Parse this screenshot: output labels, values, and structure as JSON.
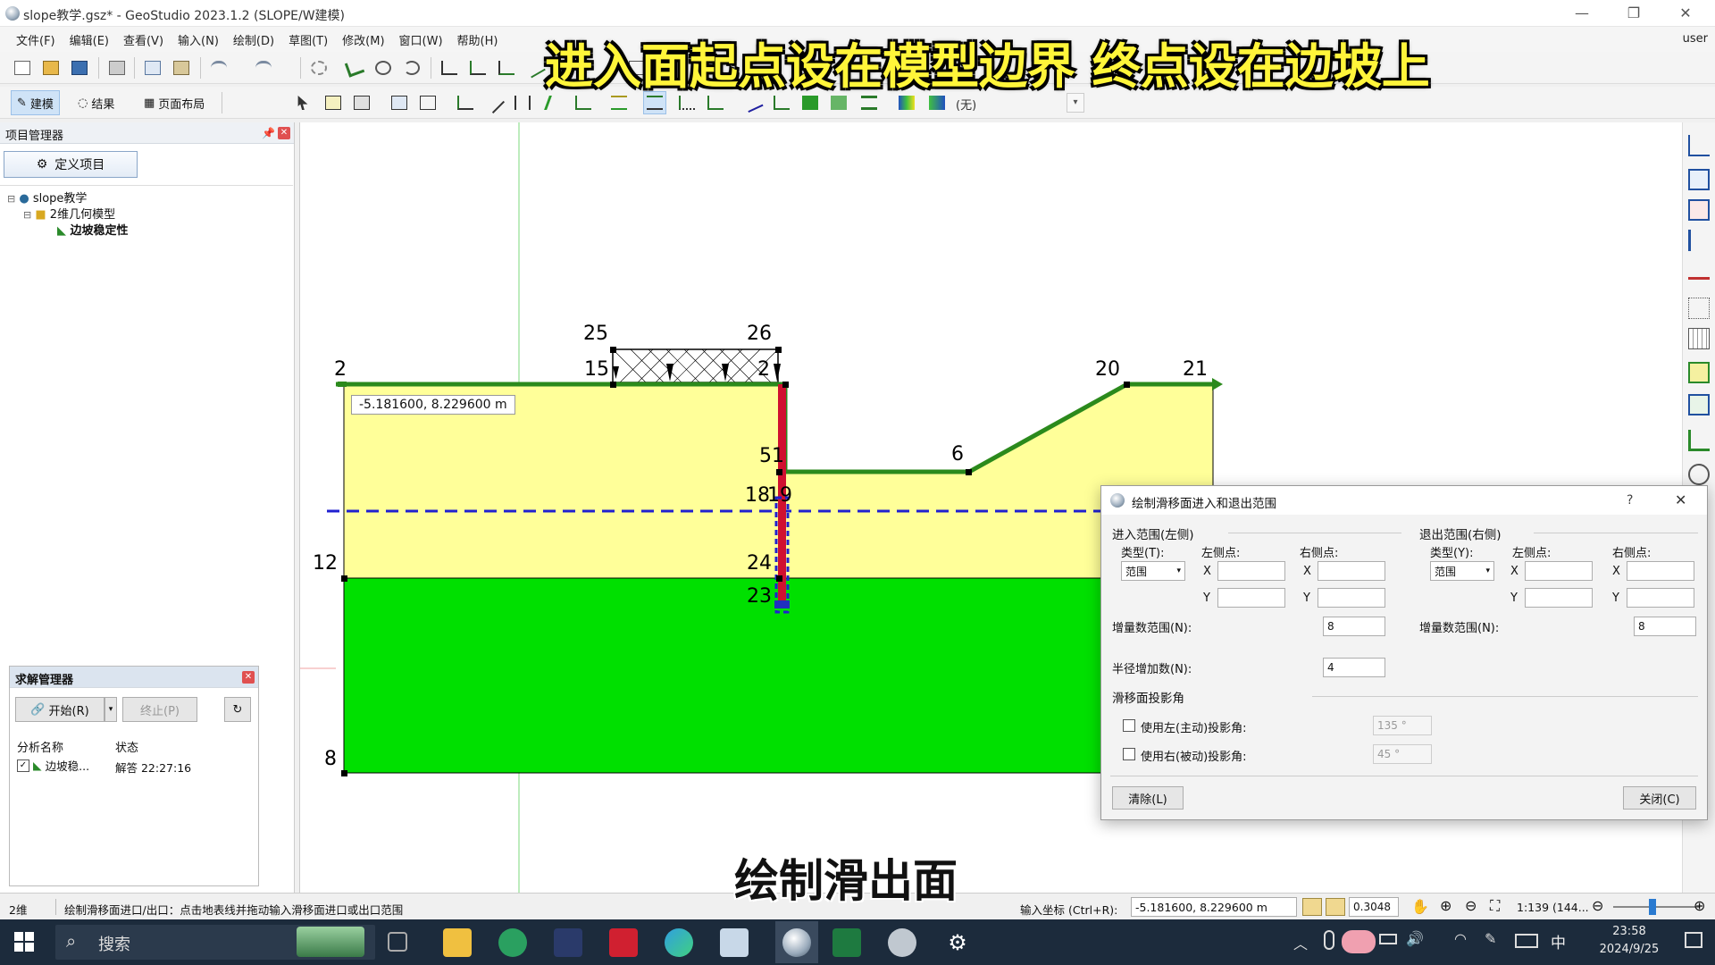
{
  "window": {
    "title": "slope教学.gsz* - GeoStudio 2023.1.2 (SLOPE/W建模)",
    "minimize": "—",
    "restore": "❐",
    "close": "✕"
  },
  "menu": {
    "items": [
      "文件(F)",
      "编辑(E)",
      "查看(V)",
      "输入(N)",
      "绘制(D)",
      "草图(T)",
      "修改(M)",
      "窗口(W)",
      "帮助(H)"
    ],
    "user": "user"
  },
  "modes": {
    "build": "建模",
    "results": "结果",
    "layout": "页面布局",
    "dropdown_value": "(无)"
  },
  "project_manager": {
    "title": "项目管理器",
    "define_button": "定义项目",
    "tree": {
      "root": "slope教学",
      "geometry": "2维几何模型",
      "analysis": "边坡稳定性"
    }
  },
  "solve_manager": {
    "title": "求解管理器",
    "start": "开始(R)",
    "stop": "终止(P)",
    "col_name": "分析名称",
    "col_status": "状态",
    "row_name": "边坡稳...",
    "row_status": "解答 22:27:16"
  },
  "canvas": {
    "coord_tooltip": "-5.181600, 8.229600 m",
    "point_labels": {
      "p2": "2",
      "p25": "25",
      "p26": "26",
      "p15": "15",
      "p2x": "2",
      "p20": "20",
      "p21": "21",
      "p5": "51",
      "p6": "6",
      "p18": "18",
      "p19": "19",
      "p12": "12",
      "p24": "24",
      "p23": "23",
      "p8": "8"
    },
    "colors": {
      "upper_soil": "#ffff99",
      "lower_soil": "#00e000",
      "boundary": "#2b8a1c",
      "water_table": "#2020d0",
      "wall": "#d01030"
    }
  },
  "dialog": {
    "title": "绘制滑移面进入和退出范围",
    "help": "?",
    "close_x": "✕",
    "entry": {
      "group": "进入范围(左侧)",
      "type_label": "类型(T):",
      "type_value": "范围",
      "left_label": "左侧点:",
      "right_label": "右侧点:",
      "x": "X",
      "y": "Y",
      "inc_label": "增量数范围(N):",
      "inc_value": "8"
    },
    "exit": {
      "group": "退出范围(右侧)",
      "type_label": "类型(Y):",
      "type_value": "范围",
      "left_label": "左侧点:",
      "right_label": "右侧点:",
      "x": "X",
      "y": "Y",
      "inc_label": "增量数范围(N):",
      "inc_value": "8"
    },
    "radius_label": "半径增加数(N):",
    "radius_value": "4",
    "projection_group": "滑移面投影角",
    "use_left": "使用左(主动)投影角:",
    "left_angle": "135 °",
    "use_right": "使用右(被动)投影角:",
    "right_angle": "45 °",
    "clear": "清除(L)",
    "close": "关闭(C)"
  },
  "statusbar": {
    "mode": "2维",
    "hint": "绘制滑移面进口/出口：点击地表线并拖动输入滑移面进口或出口范围",
    "coord_label": "输入坐标 (Ctrl+R):",
    "coord_value": "-5.181600, 8.229600 m",
    "grid_value": "0.3048",
    "scale": "1:139 (144..."
  },
  "taskbar": {
    "search": "搜索",
    "time": "23:58",
    "date": "2024/9/25",
    "ime": "中"
  },
  "captions": {
    "top": "进入面起点设在模型边界 终点设在边坡上",
    "bottom": "绘制滑出面"
  }
}
